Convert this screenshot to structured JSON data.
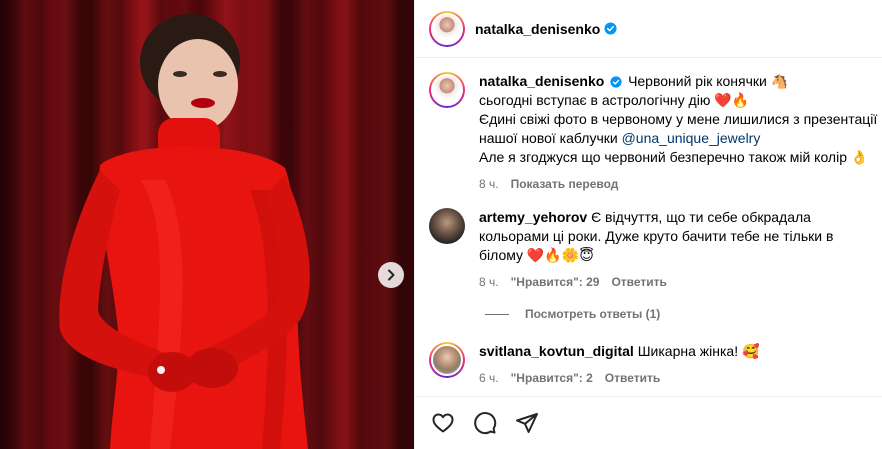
{
  "post_header": {
    "username": "natalka_denisenko"
  },
  "caption": {
    "username": "natalka_denisenko",
    "line1": "Червоний рік конячки 🐴",
    "line2": "сьогодні вступає в астрологічну дію ❤️🔥",
    "line3": "Єдині свіжі фото в червоному у мене лишилися з презентації",
    "line4_text": "нашої нової каблучки ",
    "line4_link": "@una_unique_jewelry",
    "line5": "Але я згоджуся що червоний безперечно також мій колір 👌",
    "time": "8 ч.",
    "translate": "Показать перевод"
  },
  "comments": [
    {
      "username": "artemy_yehorov",
      "text_line1": "Є відчуття, що ти себе обкрадала",
      "text_line2": "кольорами ці роки. Дуже круто бачити тебе не тільки в",
      "text_line3": "білому ❤️🔥🌼😇",
      "time": "8 ч.",
      "likes": "\"Нравится\": 29",
      "reply": "Ответить"
    },
    {
      "username": "svitlana_kovtun_digital",
      "text_line1": "Шикарна жінка! 🥰",
      "time": "6 ч.",
      "likes": "\"Нравится\": 2",
      "reply": "Ответить"
    }
  ],
  "view_replies": "Посмотреть ответы (1)",
  "icons": {
    "verified": "verified-badge-icon",
    "like": "heart-icon",
    "comment": "comment-bubble-icon",
    "share": "paper-plane-icon",
    "next": "chevron-right-icon"
  },
  "colors": {
    "verified": "#0095f6",
    "link": "#00376b",
    "meta": "#737373"
  }
}
